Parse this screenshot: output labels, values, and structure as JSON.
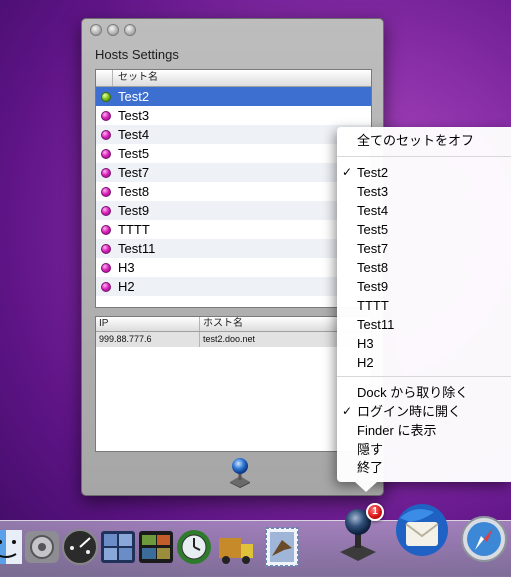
{
  "window": {
    "title": "Hosts Settings",
    "set_column_header": "セット名",
    "sets": [
      {
        "name": "Test2",
        "status": "green",
        "selected": true
      },
      {
        "name": "Test3",
        "status": "magenta"
      },
      {
        "name": "Test4",
        "status": "magenta"
      },
      {
        "name": "Test5",
        "status": "magenta"
      },
      {
        "name": "Test7",
        "status": "magenta"
      },
      {
        "name": "Test8",
        "status": "magenta"
      },
      {
        "name": "Test9",
        "status": "magenta"
      },
      {
        "name": "TTTT",
        "status": "magenta"
      },
      {
        "name": "Test11",
        "status": "magenta"
      },
      {
        "name": "H3",
        "status": "magenta"
      },
      {
        "name": "H2",
        "status": "magenta"
      }
    ],
    "host_table": {
      "headers": [
        "IP",
        "ホスト名"
      ],
      "rows": [
        [
          "999.88.777.6",
          "test2.doo.net"
        ]
      ]
    },
    "icon": "app-joystick-globe-icon"
  },
  "menu": {
    "all_off": "全てのセットをオフ",
    "sets": [
      "Test2",
      "Test3",
      "Test4",
      "Test5",
      "Test7",
      "Test8",
      "Test9",
      "TTTT",
      "Test11",
      "H3",
      "H2"
    ],
    "checked_set": "Test2",
    "remove_from_dock": "Dock から取り除く",
    "open_at_login": "ログイン時に開く",
    "show_in_finder": "Finder に表示",
    "hide": "隠す",
    "quit": "終了",
    "checkmark": "✓"
  },
  "dock": {
    "badge_count": "1",
    "items": [
      "finder-icon",
      "system-preferences-icon",
      "dashboard-icon",
      "spaces-icon",
      "photo-booth-icon",
      "time-machine-icon",
      "delivery-truck-icon",
      "mail-icon",
      "hosts-app-icon",
      "thunderbird-icon",
      "safari-icon"
    ]
  },
  "colors": {
    "selection": "#3c6fd0",
    "active_dot": "#7cc31a",
    "inactive_dot": "#d81fb8",
    "desktop": "#8a2fa8"
  }
}
